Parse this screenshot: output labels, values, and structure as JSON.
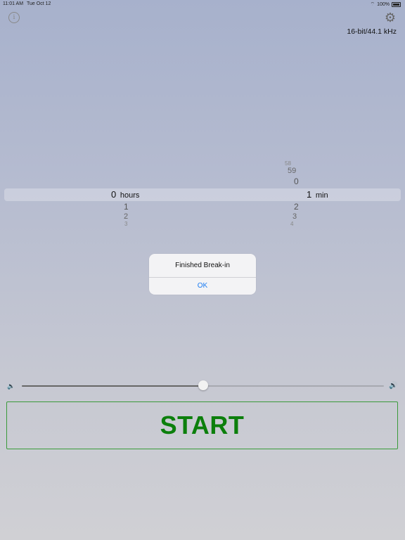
{
  "status_bar": {
    "time": "11:01 AM",
    "date": "Tue Oct 12",
    "battery": "100%"
  },
  "header": {
    "format_label": "16-bit/44.1 kHz",
    "info_icon": "info-icon",
    "settings_icon": "gear-icon"
  },
  "picker": {
    "hours": {
      "above": [],
      "selected": "0",
      "unit": "hours",
      "below": [
        "1",
        "2",
        "3"
      ]
    },
    "minutes": {
      "above": [
        "58",
        "59",
        "0"
      ],
      "selected": "1",
      "unit": "min",
      "below": [
        "2",
        "3",
        "4"
      ]
    }
  },
  "alert": {
    "title": "Finished Break-in",
    "ok_label": "OK"
  },
  "volume": {
    "level_fraction": 0.5,
    "low_icon": "speaker-low-icon",
    "high_icon": "speaker-high-icon"
  },
  "start_button": {
    "label": "START"
  },
  "colors": {
    "accent": "#1a7bf2",
    "start_green": "#0c7f0c"
  }
}
